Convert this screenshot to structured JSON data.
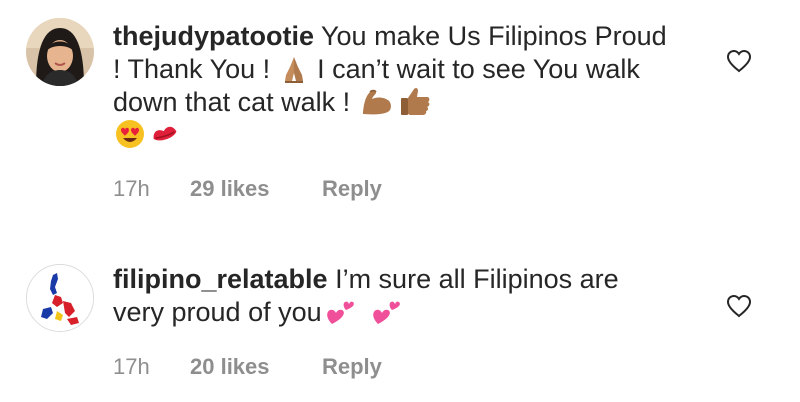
{
  "comments": [
    {
      "username": "thejudypatootie",
      "text_part1": " You make Us Filipinos Proud ! Thank You ! ",
      "text_part2": " I can’t wait to see You walk down that cat walk ! ",
      "emojis": [
        "folded-hands-emoji",
        "flexed-biceps-emoji",
        "thumbs-up-emoji",
        "heart-eyes-emoji",
        "kiss-mark-emoji"
      ],
      "time": "17h",
      "likes": "29 likes",
      "reply_label": "Reply"
    },
    {
      "username": "filipino_relatable",
      "text_part1": " I’m sure all Filipinos are very proud of you",
      "emojis": [
        "two-hearts-emoji",
        "two-hearts-emoji"
      ],
      "time": "17h",
      "likes": "20 likes",
      "reply_label": "Reply"
    }
  ],
  "colors": {
    "text": "#262626",
    "secondary": "#8e8e8e",
    "background": "#ffffff"
  }
}
